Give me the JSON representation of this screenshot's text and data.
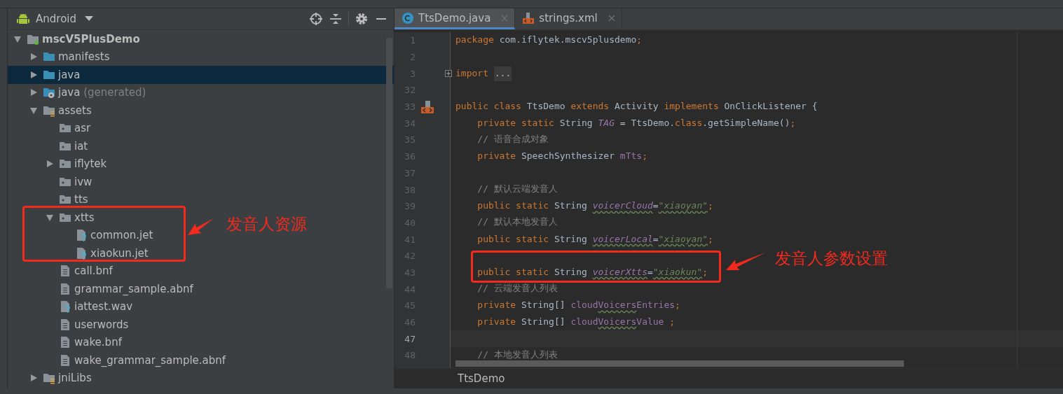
{
  "project_panel": {
    "view": "Android",
    "tree": [
      {
        "label": "mscV5PlusDemo",
        "kind": "module",
        "bold": true,
        "expanded": true,
        "selected": false,
        "children": [
          {
            "label": "manifests",
            "kind": "folder",
            "expanded": false,
            "selected": false
          },
          {
            "label": "java",
            "kind": "folder",
            "expanded": false,
            "selected": true
          },
          {
            "label": "java",
            "note": "(generated)",
            "kind": "generated",
            "expanded": false,
            "selected": false
          },
          {
            "label": "assets",
            "kind": "assets",
            "expanded": true,
            "selected": false,
            "children": [
              {
                "label": "asr",
                "kind": "package",
                "selected": false
              },
              {
                "label": "iat",
                "kind": "package",
                "selected": false
              },
              {
                "label": "iflytek",
                "kind": "package",
                "expanded": false,
                "selected": false
              },
              {
                "label": "ivw",
                "kind": "package",
                "selected": false
              },
              {
                "label": "tts",
                "kind": "package",
                "selected": false
              },
              {
                "label": "xtts",
                "kind": "package",
                "expanded": true,
                "selected": false,
                "children": [
                  {
                    "label": "common.jet",
                    "kind": "unknown",
                    "selected": false
                  },
                  {
                    "label": "xiaokun.jet",
                    "kind": "unknown",
                    "selected": false
                  }
                ]
              },
              {
                "label": "call.bnf",
                "kind": "text",
                "selected": false
              },
              {
                "label": "grammar_sample.abnf",
                "kind": "text",
                "selected": false
              },
              {
                "label": "iattest.wav",
                "kind": "unknown",
                "selected": false
              },
              {
                "label": "userwords",
                "kind": "text",
                "selected": false
              },
              {
                "label": "wake.bnf",
                "kind": "text",
                "selected": false
              },
              {
                "label": "wake_grammar_sample.abnf",
                "kind": "text",
                "selected": false
              }
            ]
          },
          {
            "label": "jniLibs",
            "kind": "assets",
            "expanded": false,
            "selected": false
          }
        ]
      }
    ]
  },
  "editor": {
    "tabs": [
      {
        "label": "TtsDemo.java",
        "kind": "class",
        "selected": true
      },
      {
        "label": "strings.xml",
        "kind": "xml",
        "selected": false
      }
    ],
    "lines": [
      {
        "number": "1",
        "tokens": [
          {
            "kind": "k",
            "text": "package "
          },
          {
            "kind": "t",
            "text": "com.iflytek.mscv5plusdemo"
          },
          {
            "kind": "k",
            "text": ";"
          }
        ]
      },
      {
        "number": "2"
      },
      {
        "number": "3",
        "fold": true,
        "tokens": [
          {
            "kind": "k",
            "text": "import "
          },
          {
            "kind": "fold",
            "text": "..."
          }
        ]
      },
      {
        "number": "32"
      },
      {
        "number": "33",
        "marker": true,
        "tokens": [
          {
            "kind": "k",
            "text": "public class "
          },
          {
            "kind": "t",
            "text": "TtsDemo "
          },
          {
            "kind": "k",
            "text": "extends "
          },
          {
            "kind": "t",
            "text": "Activity "
          },
          {
            "kind": "k",
            "text": "implements "
          },
          {
            "kind": "t",
            "text": "OnClickListener {"
          }
        ]
      },
      {
        "number": "34",
        "tokens": [
          {
            "kind": "k",
            "text": "    private static "
          },
          {
            "kind": "t",
            "text": "String "
          },
          {
            "kind": "f",
            "text": "TAG"
          },
          {
            "kind": "t",
            "text": " = TtsDemo."
          },
          {
            "kind": "k",
            "text": "class"
          },
          {
            "kind": "t",
            "text": ".getSimpleName()"
          },
          {
            "kind": "k",
            "text": ";"
          }
        ]
      },
      {
        "number": "35",
        "tokens": [
          {
            "kind": "c",
            "text": "    // 语音合成对象"
          }
        ]
      },
      {
        "number": "36",
        "tokens": [
          {
            "kind": "k",
            "text": "    private "
          },
          {
            "kind": "t",
            "text": "SpeechSynthesizer "
          },
          {
            "kind": "i",
            "text": "mTts"
          },
          {
            "kind": "k",
            "text": ";"
          }
        ]
      },
      {
        "number": "37"
      },
      {
        "number": "38",
        "tokens": [
          {
            "kind": "c",
            "text": "    // 默认云端发音人"
          }
        ]
      },
      {
        "number": "39",
        "tokens": [
          {
            "kind": "k",
            "text": "    public static "
          },
          {
            "kind": "t",
            "text": "String "
          },
          {
            "kind": "f",
            "text": "voicerCloud",
            "squiggle": true
          },
          {
            "kind": "t",
            "text": "="
          },
          {
            "kind": "s",
            "text": "\"xiaoyan\"",
            "squiggle": true
          },
          {
            "kind": "k",
            "text": ";"
          }
        ]
      },
      {
        "number": "40",
        "tokens": [
          {
            "kind": "c",
            "text": "    // 默认本地发音人"
          }
        ]
      },
      {
        "number": "41",
        "tokens": [
          {
            "kind": "k",
            "text": "    public static "
          },
          {
            "kind": "t",
            "text": "String "
          },
          {
            "kind": "f",
            "text": "voicerLocal",
            "squiggle": true
          },
          {
            "kind": "t",
            "text": "="
          },
          {
            "kind": "s",
            "text": "\"xiaoyan\"",
            "squiggle": true
          },
          {
            "kind": "k",
            "text": ";"
          }
        ]
      },
      {
        "number": "42"
      },
      {
        "number": "43",
        "tokens": [
          {
            "kind": "k",
            "text": "    public static "
          },
          {
            "kind": "t",
            "text": "String "
          },
          {
            "kind": "f",
            "text": "voicerXtts",
            "squiggle": true
          },
          {
            "kind": "t",
            "text": "="
          },
          {
            "kind": "s",
            "text": "\"xiaokun\"",
            "squiggle": true
          },
          {
            "kind": "k",
            "text": ";"
          }
        ]
      },
      {
        "number": "44",
        "tokens": [
          {
            "kind": "c",
            "text": "    // 云端发音人列表"
          }
        ]
      },
      {
        "number": "45",
        "tokens": [
          {
            "kind": "k",
            "text": "    private "
          },
          {
            "kind": "t",
            "text": "String[] "
          },
          {
            "kind": "i",
            "text": "cloud"
          },
          {
            "kind": "i",
            "text": "Voicers",
            "squiggle": true
          },
          {
            "kind": "i",
            "text": "Entries"
          },
          {
            "kind": "k",
            "text": ";"
          }
        ]
      },
      {
        "number": "46",
        "tokens": [
          {
            "kind": "k",
            "text": "    private "
          },
          {
            "kind": "t",
            "text": "String[] "
          },
          {
            "kind": "i",
            "text": "cloud"
          },
          {
            "kind": "i",
            "text": "Voicers",
            "squiggle": true
          },
          {
            "kind": "i",
            "text": "Value "
          },
          {
            "kind": "k",
            "text": ";"
          }
        ]
      },
      {
        "number": "47",
        "current": true
      },
      {
        "number": "48",
        "tokens": [
          {
            "kind": "c",
            "text": "    // 本地发音人列表"
          }
        ]
      }
    ],
    "breadcrumb": "TtsDemo"
  },
  "annotations": [
    {
      "text": "发音人资源"
    },
    {
      "text": "发音人参数设置"
    }
  ]
}
